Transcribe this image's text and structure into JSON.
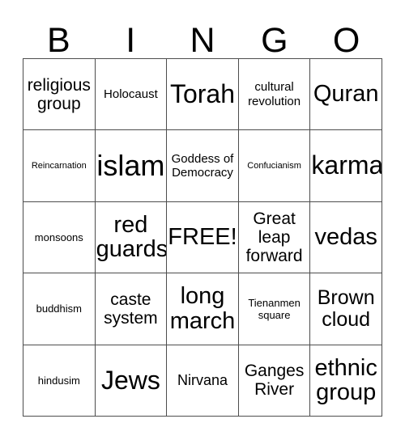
{
  "card": {
    "title": "BINGO",
    "header_letters": [
      "B",
      "I",
      "N",
      "G",
      "O"
    ],
    "free_space_label": "FREE!",
    "colors": {
      "background": "#ffffff",
      "text": "#000000",
      "border": "#4d4d4d"
    },
    "grid": {
      "columns": 5,
      "rows": 5,
      "cells": [
        {
          "text": "religious group",
          "size": "fs-l"
        },
        {
          "text": "Holocaust",
          "size": "fs-s"
        },
        {
          "text": "Torah",
          "size": "fs-3xl"
        },
        {
          "text": "cultural revolution",
          "size": "fs-s"
        },
        {
          "text": "Quran",
          "size": "fs-xxl"
        },
        {
          "text": "Reincarnation",
          "size": "fs-xxs"
        },
        {
          "text": "islam",
          "size": "fs-4xl"
        },
        {
          "text": "Goddess of Democracy",
          "size": "fs-s"
        },
        {
          "text": "Confucianism",
          "size": "fs-xxs"
        },
        {
          "text": "karma",
          "size": "fs-3xl"
        },
        {
          "text": "monsoons",
          "size": "fs-xs"
        },
        {
          "text": "red guards",
          "size": "fs-xxl"
        },
        {
          "text": "FREE!",
          "size": "fs-xxl"
        },
        {
          "text": "Great leap forward",
          "size": "fs-l"
        },
        {
          "text": "vedas",
          "size": "fs-xxl"
        },
        {
          "text": "buddhism",
          "size": "fs-xs"
        },
        {
          "text": "caste system",
          "size": "fs-l"
        },
        {
          "text": "long march",
          "size": "fs-xxl"
        },
        {
          "text": "Tienanmen square",
          "size": "fs-xs"
        },
        {
          "text": "Brown cloud",
          "size": "fs-xl"
        },
        {
          "text": "hindusim",
          "size": "fs-xs"
        },
        {
          "text": "Jews",
          "size": "fs-3xl"
        },
        {
          "text": "Nirvana",
          "size": "fs-m"
        },
        {
          "text": "Ganges River",
          "size": "fs-l"
        },
        {
          "text": "ethnic group",
          "size": "fs-xxl"
        }
      ]
    }
  }
}
